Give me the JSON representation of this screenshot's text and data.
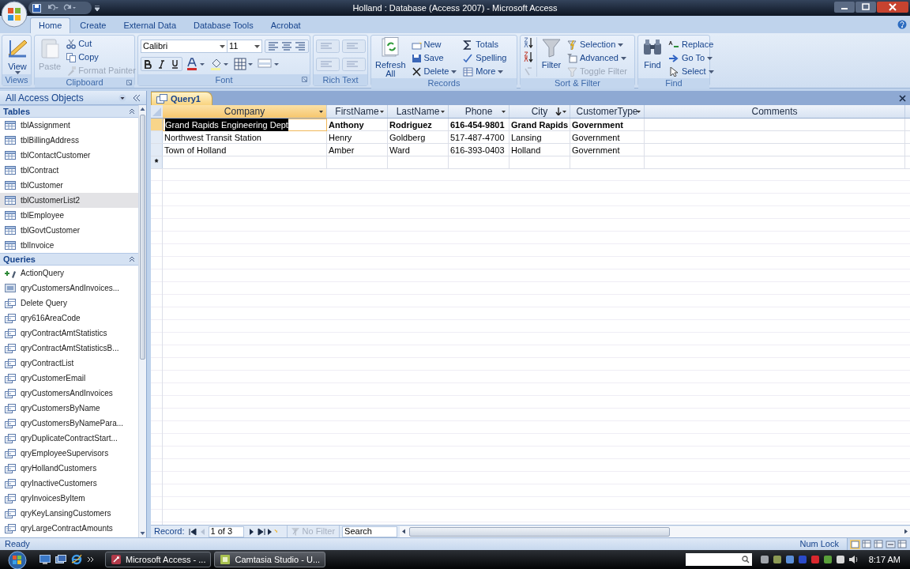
{
  "window": {
    "title": "Holland : Database (Access 2007) - Microsoft Access"
  },
  "ribbon_tabs": [
    {
      "label": "Home",
      "selected": true
    },
    {
      "label": "Create",
      "selected": false
    },
    {
      "label": "External Data",
      "selected": false
    },
    {
      "label": "Database Tools",
      "selected": false
    },
    {
      "label": "Acrobat",
      "selected": false
    }
  ],
  "ribbon": {
    "views": {
      "label": "Views",
      "view": "View"
    },
    "clipboard": {
      "label": "Clipboard",
      "paste": {
        "label": "Paste",
        "disabled": true
      },
      "items": [
        {
          "label": "Cut",
          "disabled": false
        },
        {
          "label": "Copy",
          "disabled": false
        },
        {
          "label": "Format Painter",
          "disabled": true
        }
      ]
    },
    "font": {
      "label": "Font",
      "font_name": "Calibri",
      "font_size": "11"
    },
    "rich_text": {
      "label": "Rich Text"
    },
    "records": {
      "label": "Records",
      "refresh": "Refresh All",
      "items": [
        {
          "label": "New",
          "dropdown": false
        },
        {
          "label": "Save",
          "dropdown": false
        },
        {
          "label": "Delete",
          "dropdown": true
        },
        {
          "label": "Totals",
          "dropdown": false
        },
        {
          "label": "Spelling",
          "dropdown": false
        },
        {
          "label": "More",
          "dropdown": true
        }
      ]
    },
    "sort_filter": {
      "label": "Sort & Filter",
      "filter": "Filter",
      "items": [
        {
          "label": "Selection",
          "dropdown": true,
          "disabled": false
        },
        {
          "label": "Advanced",
          "dropdown": true,
          "disabled": false
        },
        {
          "label": "Toggle Filter",
          "dropdown": false,
          "disabled": true
        }
      ]
    },
    "find": {
      "label": "Find",
      "find": "Find",
      "items": [
        {
          "label": "Replace",
          "dropdown": false
        },
        {
          "label": "Go To",
          "dropdown": true
        },
        {
          "label": "Select",
          "dropdown": true
        }
      ]
    }
  },
  "nav_pane": {
    "title": "All Access Objects",
    "groups": [
      {
        "label": "Tables",
        "items": [
          {
            "label": "tblAssignment",
            "selected": false
          },
          {
            "label": "tblBillingAddress",
            "selected": false
          },
          {
            "label": "tblContactCustomer",
            "selected": false
          },
          {
            "label": "tblContract",
            "selected": false
          },
          {
            "label": "tblCustomer",
            "selected": false
          },
          {
            "label": "tblCustomerList2",
            "selected": true
          },
          {
            "label": "tblEmployee",
            "selected": false
          },
          {
            "label": "tblGovtCustomer",
            "selected": false
          },
          {
            "label": "tblInvoice",
            "selected": false
          }
        ]
      },
      {
        "label": "Queries",
        "items": [
          {
            "label": "ActionQuery",
            "kind": "action",
            "selected": false
          },
          {
            "label": "qryCustomersAndInvoices...",
            "kind": "form",
            "selected": false
          },
          {
            "label": "Delete Query",
            "kind": "select",
            "selected": false
          },
          {
            "label": "qry616AreaCode",
            "kind": "select",
            "selected": false
          },
          {
            "label": "qryContractAmtStatistics",
            "kind": "select",
            "selected": false
          },
          {
            "label": "qryContractAmtStatisticsB...",
            "kind": "select",
            "selected": false
          },
          {
            "label": "qryContractList",
            "kind": "select",
            "selected": false
          },
          {
            "label": "qryCustomerEmail",
            "kind": "select",
            "selected": false
          },
          {
            "label": "qryCustomersAndInvoices",
            "kind": "select",
            "selected": false
          },
          {
            "label": "qryCustomersByName",
            "kind": "select",
            "selected": false
          },
          {
            "label": "qryCustomersByNamePara...",
            "kind": "select",
            "selected": false
          },
          {
            "label": "qryDuplicateContractStart...",
            "kind": "select",
            "selected": false
          },
          {
            "label": "qryEmployeeSupervisors",
            "kind": "select",
            "selected": false
          },
          {
            "label": "qryHollandCustomers",
            "kind": "select",
            "selected": false
          },
          {
            "label": "qryInactiveCustomers",
            "kind": "select",
            "selected": false
          },
          {
            "label": "qryInvoicesByItem",
            "kind": "select",
            "selected": false
          },
          {
            "label": "qryKeyLansingCustomers",
            "kind": "select",
            "selected": false
          },
          {
            "label": "qryLargeContractAmounts",
            "kind": "select",
            "selected": false
          }
        ]
      }
    ]
  },
  "document_tab": "Query1",
  "datasheet": {
    "columns": [
      {
        "label": "Company",
        "selected": true,
        "sorted": false,
        "filter_menu": true
      },
      {
        "label": "FirstName",
        "selected": false,
        "sorted": false,
        "filter_menu": true
      },
      {
        "label": "LastName",
        "selected": false,
        "sorted": false,
        "filter_menu": true
      },
      {
        "label": "Phone",
        "selected": false,
        "sorted": false,
        "filter_menu": true
      },
      {
        "label": "City",
        "selected": false,
        "sorted": true,
        "filter_menu": true
      },
      {
        "label": "CustomerType",
        "selected": false,
        "sorted": false,
        "filter_menu": true
      },
      {
        "label": "Comments",
        "selected": false,
        "sorted": false,
        "filter_menu": false
      }
    ],
    "rows": [
      {
        "selected": true,
        "cells": [
          "Grand Rapids Engineering Dept",
          "Anthony",
          "Rodriguez",
          "616-454-9801",
          "Grand Rapids",
          "Government",
          ""
        ]
      },
      {
        "selected": false,
        "cells": [
          "Northwest Transit Station",
          "Henry",
          "Goldberg",
          "517-487-4700",
          "Lansing",
          "Government",
          ""
        ]
      },
      {
        "selected": false,
        "cells": [
          "Town of Holland",
          "Amber",
          "Ward",
          "616-393-0403",
          "Holland",
          "Government",
          ""
        ]
      }
    ],
    "new_row_marker": "*"
  },
  "record_nav": {
    "label": "Record:",
    "position": "1 of 3",
    "filter": {
      "label": "No Filter",
      "disabled": true
    },
    "search": {
      "placeholder": "Search"
    }
  },
  "status_bar": {
    "text": "Ready",
    "num_lock": "Num Lock"
  },
  "taskbar": {
    "buttons": [
      {
        "label": "Microsoft Access - ...",
        "selected": true
      },
      {
        "label": "Camtasia Studio - U...",
        "selected": false
      }
    ],
    "clock": "8:17 AM"
  }
}
